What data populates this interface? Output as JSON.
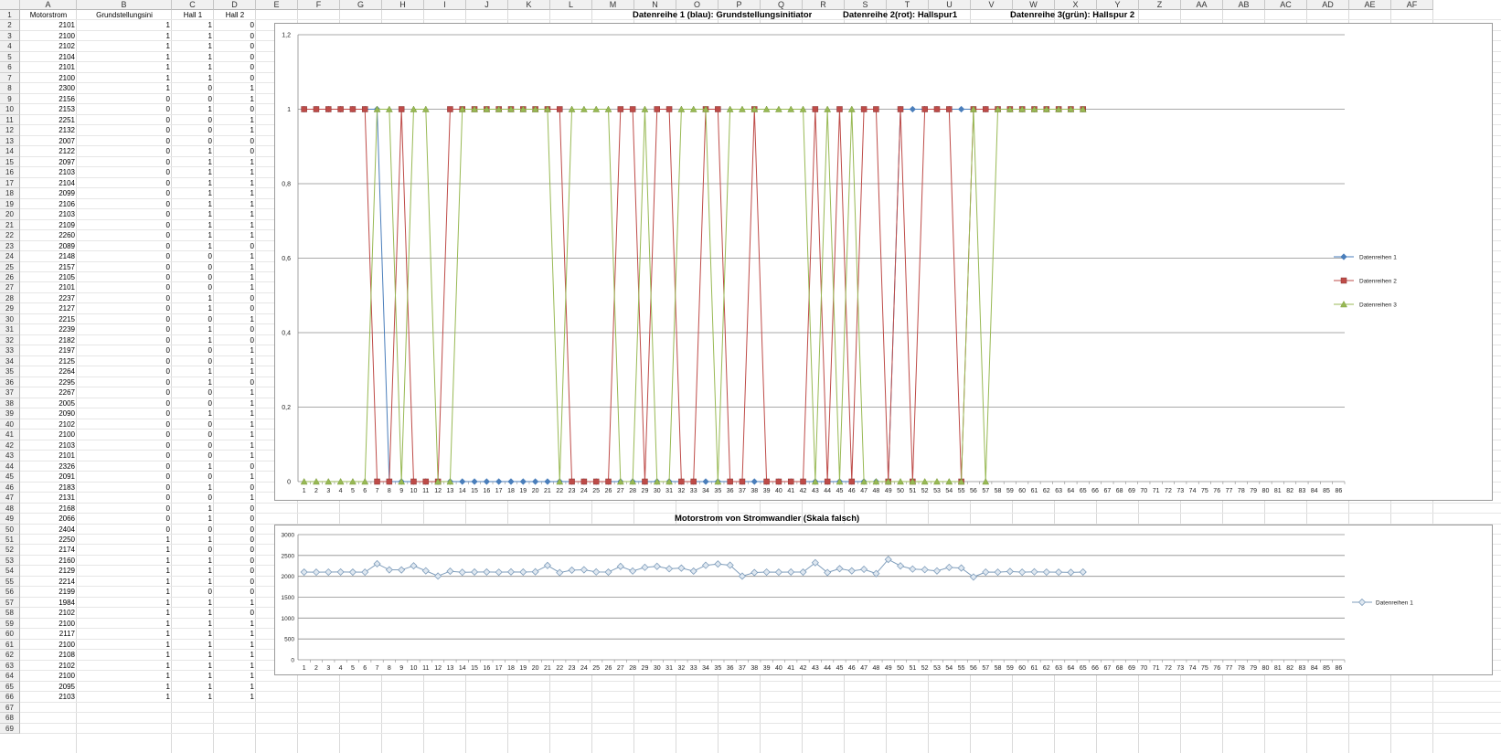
{
  "columns": [
    "A",
    "B",
    "C",
    "D",
    "E",
    "F",
    "G",
    "H",
    "I",
    "J",
    "K",
    "L",
    "M",
    "N",
    "O",
    "P",
    "Q",
    "R",
    "S",
    "T",
    "U",
    "V",
    "W",
    "X",
    "Y",
    "Z",
    "AA",
    "AB",
    "AC",
    "AD",
    "AE",
    "AF"
  ],
  "headers": [
    "Motorstrom",
    "Grundstellungsini",
    "Hall 1",
    "Hall 2"
  ],
  "rows": [
    [
      2101,
      1,
      1,
      0
    ],
    [
      2100,
      1,
      1,
      0
    ],
    [
      2102,
      1,
      1,
      0
    ],
    [
      2104,
      1,
      1,
      0
    ],
    [
      2101,
      1,
      1,
      0
    ],
    [
      2100,
      1,
      1,
      0
    ],
    [
      2300,
      1,
      0,
      1
    ],
    [
      2156,
      0,
      0,
      1
    ],
    [
      2153,
      0,
      1,
      0
    ],
    [
      2251,
      0,
      0,
      1
    ],
    [
      2132,
      0,
      0,
      1
    ],
    [
      2007,
      0,
      0,
      0
    ],
    [
      2122,
      0,
      1,
      0
    ],
    [
      2097,
      0,
      1,
      1
    ],
    [
      2103,
      0,
      1,
      1
    ],
    [
      2104,
      0,
      1,
      1
    ],
    [
      2099,
      0,
      1,
      1
    ],
    [
      2106,
      0,
      1,
      1
    ],
    [
      2103,
      0,
      1,
      1
    ],
    [
      2109,
      0,
      1,
      1
    ],
    [
      2260,
      0,
      1,
      1
    ],
    [
      2089,
      0,
      1,
      0
    ],
    [
      2148,
      0,
      0,
      1
    ],
    [
      2157,
      0,
      0,
      1
    ],
    [
      2105,
      0,
      0,
      1
    ],
    [
      2101,
      0,
      0,
      1
    ],
    [
      2237,
      0,
      1,
      0
    ],
    [
      2127,
      0,
      1,
      0
    ],
    [
      2215,
      0,
      0,
      1
    ],
    [
      2239,
      0,
      1,
      0
    ],
    [
      2182,
      0,
      1,
      0
    ],
    [
      2197,
      0,
      0,
      1
    ],
    [
      2125,
      0,
      0,
      1
    ],
    [
      2264,
      0,
      1,
      1
    ],
    [
      2295,
      0,
      1,
      0
    ],
    [
      2267,
      0,
      0,
      1
    ],
    [
      2005,
      0,
      0,
      1
    ],
    [
      2090,
      0,
      1,
      1
    ],
    [
      2102,
      0,
      0,
      1
    ],
    [
      2100,
      0,
      0,
      1
    ],
    [
      2103,
      0,
      0,
      1
    ],
    [
      2101,
      0,
      0,
      1
    ],
    [
      2326,
      0,
      1,
      0
    ],
    [
      2091,
      0,
      0,
      1
    ],
    [
      2183,
      0,
      1,
      0
    ],
    [
      2131,
      0,
      0,
      1
    ],
    [
      2168,
      0,
      1,
      0
    ],
    [
      2066,
      0,
      1,
      0
    ],
    [
      2404,
      0,
      0,
      0
    ],
    [
      2250,
      1,
      1,
      0
    ],
    [
      2174,
      1,
      0,
      0
    ],
    [
      2160,
      1,
      1,
      0
    ],
    [
      2129,
      1,
      1,
      0
    ],
    [
      2214,
      1,
      1,
      0
    ],
    [
      2199,
      1,
      0,
      0
    ],
    [
      1984,
      1,
      1,
      1
    ],
    [
      2102,
      1,
      1,
      0
    ],
    [
      2100,
      1,
      1,
      1
    ],
    [
      2117,
      1,
      1,
      1
    ],
    [
      2100,
      1,
      1,
      1
    ],
    [
      2108,
      1,
      1,
      1
    ],
    [
      2102,
      1,
      1,
      1
    ],
    [
      2100,
      1,
      1,
      1
    ],
    [
      2095,
      1,
      1,
      1
    ],
    [
      2103,
      1,
      1,
      1
    ]
  ],
  "charts": {
    "top": {
      "titles": [
        "Datenreihe 1 (blau): Grundstellungsinitiator",
        "Datenreihe 2(rot): Hallspur1",
        "Datenreihe 3(grün): Hallspur 2"
      ],
      "legend": [
        "Datenreihen 1",
        "Datenreihen 2",
        "Datenreihen 3"
      ],
      "series_colors": [
        "#4a7ebb",
        "#be4b48",
        "#98b954"
      ],
      "yticks": [
        "0",
        "0,2",
        "0,4",
        "0,6",
        "0,8",
        "1",
        "1,2"
      ]
    },
    "bottom": {
      "title": "Motorstrom von Stromwandler (Skala falsch)",
      "legend": [
        "Datenreihen 1"
      ],
      "series_color": "#7f9dbb",
      "yticks": [
        "0",
        "500",
        "1000",
        "1500",
        "2000",
        "2500",
        "3000"
      ]
    }
  },
  "chart_data": [
    {
      "type": "line",
      "title": "Datenreihe 1 (blau): Grundstellungsinitiator   Datenreihe 2(rot): Hallspur1   Datenreihe 3(grün): Hallspur 2",
      "x_categories": "1..86",
      "ylim": [
        0,
        1.2
      ],
      "series": [
        {
          "name": "Datenreihen 1",
          "values": [
            1,
            1,
            1,
            1,
            1,
            1,
            1,
            0,
            0,
            0,
            0,
            0,
            0,
            0,
            0,
            0,
            0,
            0,
            0,
            0,
            0,
            0,
            0,
            0,
            0,
            0,
            0,
            0,
            0,
            0,
            0,
            0,
            0,
            0,
            0,
            0,
            0,
            0,
            0,
            0,
            0,
            0,
            0,
            0,
            0,
            0,
            0,
            0,
            0,
            1,
            1,
            1,
            1,
            1,
            1,
            1,
            1,
            1,
            1,
            1,
            1,
            1,
            1,
            1,
            1
          ]
        },
        {
          "name": "Datenreihen 2",
          "values": [
            1,
            1,
            1,
            1,
            1,
            1,
            0,
            0,
            1,
            0,
            0,
            0,
            1,
            1,
            1,
            1,
            1,
            1,
            1,
            1,
            1,
            1,
            0,
            0,
            0,
            0,
            1,
            1,
            0,
            1,
            1,
            0,
            0,
            1,
            1,
            0,
            0,
            1,
            0,
            0,
            0,
            0,
            1,
            0,
            1,
            0,
            1,
            1,
            0,
            1,
            0,
            1,
            1,
            1,
            0,
            1,
            1,
            1,
            1,
            1,
            1,
            1,
            1,
            1,
            1
          ]
        },
        {
          "name": "Datenreihen 3",
          "values": [
            0,
            0,
            0,
            0,
            0,
            0,
            1,
            1,
            0,
            1,
            1,
            0,
            0,
            1,
            1,
            1,
            1,
            1,
            1,
            1,
            1,
            0,
            1,
            1,
            1,
            1,
            0,
            0,
            1,
            0,
            0,
            1,
            1,
            1,
            0,
            1,
            1,
            1,
            1,
            1,
            1,
            1,
            0,
            1,
            0,
            1,
            0,
            0,
            0,
            0,
            0,
            0,
            0,
            0,
            0,
            1,
            0,
            1,
            1,
            1,
            1,
            1,
            1,
            1,
            1
          ]
        }
      ]
    },
    {
      "type": "line",
      "title": "Motorstrom von Stromwandler (Skala falsch)",
      "x_categories": "1..86",
      "ylim": [
        0,
        3000
      ],
      "series": [
        {
          "name": "Datenreihen 1",
          "values": [
            2101,
            2100,
            2102,
            2104,
            2101,
            2100,
            2300,
            2156,
            2153,
            2251,
            2132,
            2007,
            2122,
            2097,
            2103,
            2104,
            2099,
            2106,
            2103,
            2109,
            2260,
            2089,
            2148,
            2157,
            2105,
            2101,
            2237,
            2127,
            2215,
            2239,
            2182,
            2197,
            2125,
            2264,
            2295,
            2267,
            2005,
            2090,
            2102,
            2100,
            2103,
            2101,
            2326,
            2091,
            2183,
            2131,
            2168,
            2066,
            2404,
            2250,
            2174,
            2160,
            2129,
            2214,
            2199,
            1984,
            2102,
            2100,
            2117,
            2100,
            2108,
            2102,
            2100,
            2095,
            2103
          ]
        }
      ]
    }
  ]
}
